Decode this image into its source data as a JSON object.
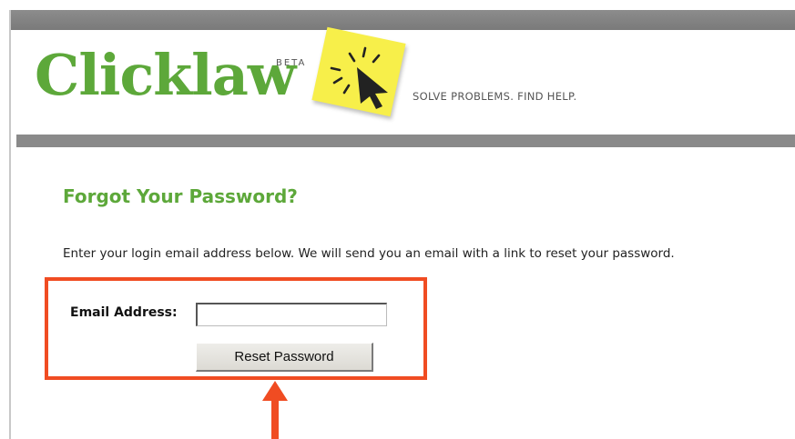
{
  "header": {
    "logo_text": "Clicklaw",
    "beta_label": "BETA",
    "tagline": "SOLVE PROBLEMS. FIND HELP.",
    "icon": "cursor-sticky-note-icon"
  },
  "main": {
    "heading": "Forgot Your Password?",
    "instructions": "Enter your login email address below. We will send you an email with a link to reset your password.",
    "form": {
      "email_label": "Email Address:",
      "email_value": "",
      "reset_button_label": "Reset Password"
    }
  },
  "annotation": {
    "highlight_color": "#f04c22",
    "arrow_icon": "up-arrow-icon"
  },
  "colors": {
    "brand_green": "#5da83a",
    "header_bar": "#7f7f7f",
    "sticky_note": "#f7ef4a"
  }
}
